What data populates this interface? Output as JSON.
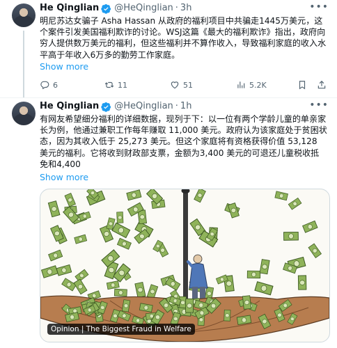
{
  "tweets": [
    {
      "name": "He Qinglian",
      "handle": "@HeQinglian",
      "time": "3h",
      "text": "明尼苏达女骗子 Asha Hassan 从政府的福利项目中共骗走1445万美元，这个案件引发美国福利欺诈的讨论。WSJ这篇《最大的福利欺诈》指出，政府向穷人提供数万美元的福利，但这些福利并不算作收入，导致福利家庭的收入水平高于年收入6万多的勤劳工作家庭。",
      "show_more": "Show more",
      "stats": {
        "replies": "6",
        "reposts": "11",
        "likes": "51",
        "views": "5.2K"
      }
    },
    {
      "name": "He Qinglian",
      "handle": "@HeQinglian",
      "time": "1h",
      "text": "有网友希望细分福利的详细数据，现列于下：以一位有两个学龄儿童的单亲家长为例，他通过兼职工作每年赚取 11,000 美元。政府认为该家庭处于贫困状态，因为其收入低于 25,273 美元。但这个家庭将有资格获得价值 53,128 美元的福利。它将收到财政部支票，金额为3,400 美元的可退还儿童税收抵免和4,400",
      "show_more": "Show more",
      "media_caption": "Opinion | The Biggest Fraud in Welfare"
    }
  ],
  "colors": {
    "accent": "#1d9bf0",
    "muted": "#536471",
    "money": "#8fb35a"
  },
  "icons": [
    "verified-badge-icon",
    "reply-icon",
    "repost-icon",
    "like-icon",
    "views-icon",
    "bookmark-icon",
    "share-icon",
    "more-icon"
  ]
}
